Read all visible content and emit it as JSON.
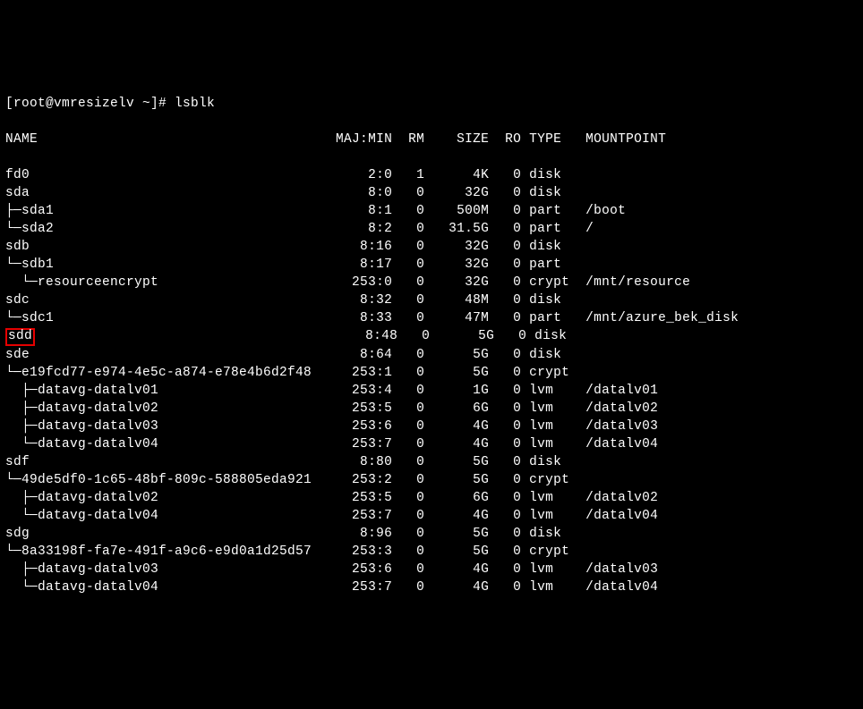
{
  "prompt": "[root@vmresizelv ~]# lsblk",
  "header": {
    "name": "NAME",
    "majmin": "MAJ:MIN",
    "rm": "RM",
    "size": "SIZE",
    "ro": "RO",
    "type": "TYPE",
    "mountpoint": "MOUNTPOINT"
  },
  "rows": [
    {
      "name": "fd0",
      "prefix": "",
      "majmin": "2:0",
      "rm": "1",
      "size": "4K",
      "ro": "0",
      "type": "disk",
      "mountpoint": "",
      "highlight": false
    },
    {
      "name": "sda",
      "prefix": "",
      "majmin": "8:0",
      "rm": "0",
      "size": "32G",
      "ro": "0",
      "type": "disk",
      "mountpoint": "",
      "highlight": false
    },
    {
      "name": "sda1",
      "prefix": "├─",
      "majmin": "8:1",
      "rm": "0",
      "size": "500M",
      "ro": "0",
      "type": "part",
      "mountpoint": "/boot",
      "highlight": false
    },
    {
      "name": "sda2",
      "prefix": "└─",
      "majmin": "8:2",
      "rm": "0",
      "size": "31.5G",
      "ro": "0",
      "type": "part",
      "mountpoint": "/",
      "highlight": false
    },
    {
      "name": "sdb",
      "prefix": "",
      "majmin": "8:16",
      "rm": "0",
      "size": "32G",
      "ro": "0",
      "type": "disk",
      "mountpoint": "",
      "highlight": false
    },
    {
      "name": "sdb1",
      "prefix": "└─",
      "majmin": "8:17",
      "rm": "0",
      "size": "32G",
      "ro": "0",
      "type": "part",
      "mountpoint": "",
      "highlight": false
    },
    {
      "name": "resourceencrypt",
      "prefix": "  └─",
      "majmin": "253:0",
      "rm": "0",
      "size": "32G",
      "ro": "0",
      "type": "crypt",
      "mountpoint": "/mnt/resource",
      "highlight": false
    },
    {
      "name": "sdc",
      "prefix": "",
      "majmin": "8:32",
      "rm": "0",
      "size": "48M",
      "ro": "0",
      "type": "disk",
      "mountpoint": "",
      "highlight": false
    },
    {
      "name": "sdc1",
      "prefix": "└─",
      "majmin": "8:33",
      "rm": "0",
      "size": "47M",
      "ro": "0",
      "type": "part",
      "mountpoint": "/mnt/azure_bek_disk",
      "highlight": false
    },
    {
      "name": "sdd",
      "prefix": "",
      "majmin": "8:48",
      "rm": "0",
      "size": "5G",
      "ro": "0",
      "type": "disk",
      "mountpoint": "",
      "highlight": true
    },
    {
      "name": "sde",
      "prefix": "",
      "majmin": "8:64",
      "rm": "0",
      "size": "5G",
      "ro": "0",
      "type": "disk",
      "mountpoint": "",
      "highlight": false
    },
    {
      "name": "e19fcd77-e974-4e5c-a874-e78e4b6d2f48",
      "prefix": "└─",
      "majmin": "253:1",
      "rm": "0",
      "size": "5G",
      "ro": "0",
      "type": "crypt",
      "mountpoint": "",
      "highlight": false
    },
    {
      "name": "datavg-datalv01",
      "prefix": "  ├─",
      "majmin": "253:4",
      "rm": "0",
      "size": "1G",
      "ro": "0",
      "type": "lvm",
      "mountpoint": "/datalv01",
      "highlight": false
    },
    {
      "name": "datavg-datalv02",
      "prefix": "  ├─",
      "majmin": "253:5",
      "rm": "0",
      "size": "6G",
      "ro": "0",
      "type": "lvm",
      "mountpoint": "/datalv02",
      "highlight": false
    },
    {
      "name": "datavg-datalv03",
      "prefix": "  ├─",
      "majmin": "253:6",
      "rm": "0",
      "size": "4G",
      "ro": "0",
      "type": "lvm",
      "mountpoint": "/datalv03",
      "highlight": false
    },
    {
      "name": "datavg-datalv04",
      "prefix": "  └─",
      "majmin": "253:7",
      "rm": "0",
      "size": "4G",
      "ro": "0",
      "type": "lvm",
      "mountpoint": "/datalv04",
      "highlight": false
    },
    {
      "name": "sdf",
      "prefix": "",
      "majmin": "8:80",
      "rm": "0",
      "size": "5G",
      "ro": "0",
      "type": "disk",
      "mountpoint": "",
      "highlight": false
    },
    {
      "name": "49de5df0-1c65-48bf-809c-588805eda921",
      "prefix": "└─",
      "majmin": "253:2",
      "rm": "0",
      "size": "5G",
      "ro": "0",
      "type": "crypt",
      "mountpoint": "",
      "highlight": false
    },
    {
      "name": "datavg-datalv02",
      "prefix": "  ├─",
      "majmin": "253:5",
      "rm": "0",
      "size": "6G",
      "ro": "0",
      "type": "lvm",
      "mountpoint": "/datalv02",
      "highlight": false
    },
    {
      "name": "datavg-datalv04",
      "prefix": "  └─",
      "majmin": "253:7",
      "rm": "0",
      "size": "4G",
      "ro": "0",
      "type": "lvm",
      "mountpoint": "/datalv04",
      "highlight": false
    },
    {
      "name": "sdg",
      "prefix": "",
      "majmin": "8:96",
      "rm": "0",
      "size": "5G",
      "ro": "0",
      "type": "disk",
      "mountpoint": "",
      "highlight": false
    },
    {
      "name": "8a33198f-fa7e-491f-a9c6-e9d0a1d25d57",
      "prefix": "└─",
      "majmin": "253:3",
      "rm": "0",
      "size": "5G",
      "ro": "0",
      "type": "crypt",
      "mountpoint": "",
      "highlight": false
    },
    {
      "name": "datavg-datalv03",
      "prefix": "  ├─",
      "majmin": "253:6",
      "rm": "0",
      "size": "4G",
      "ro": "0",
      "type": "lvm",
      "mountpoint": "/datalv03",
      "highlight": false
    },
    {
      "name": "datavg-datalv04",
      "prefix": "  └─",
      "majmin": "253:7",
      "rm": "0",
      "size": "4G",
      "ro": "0",
      "type": "lvm",
      "mountpoint": "/datalv04",
      "highlight": false
    }
  ]
}
